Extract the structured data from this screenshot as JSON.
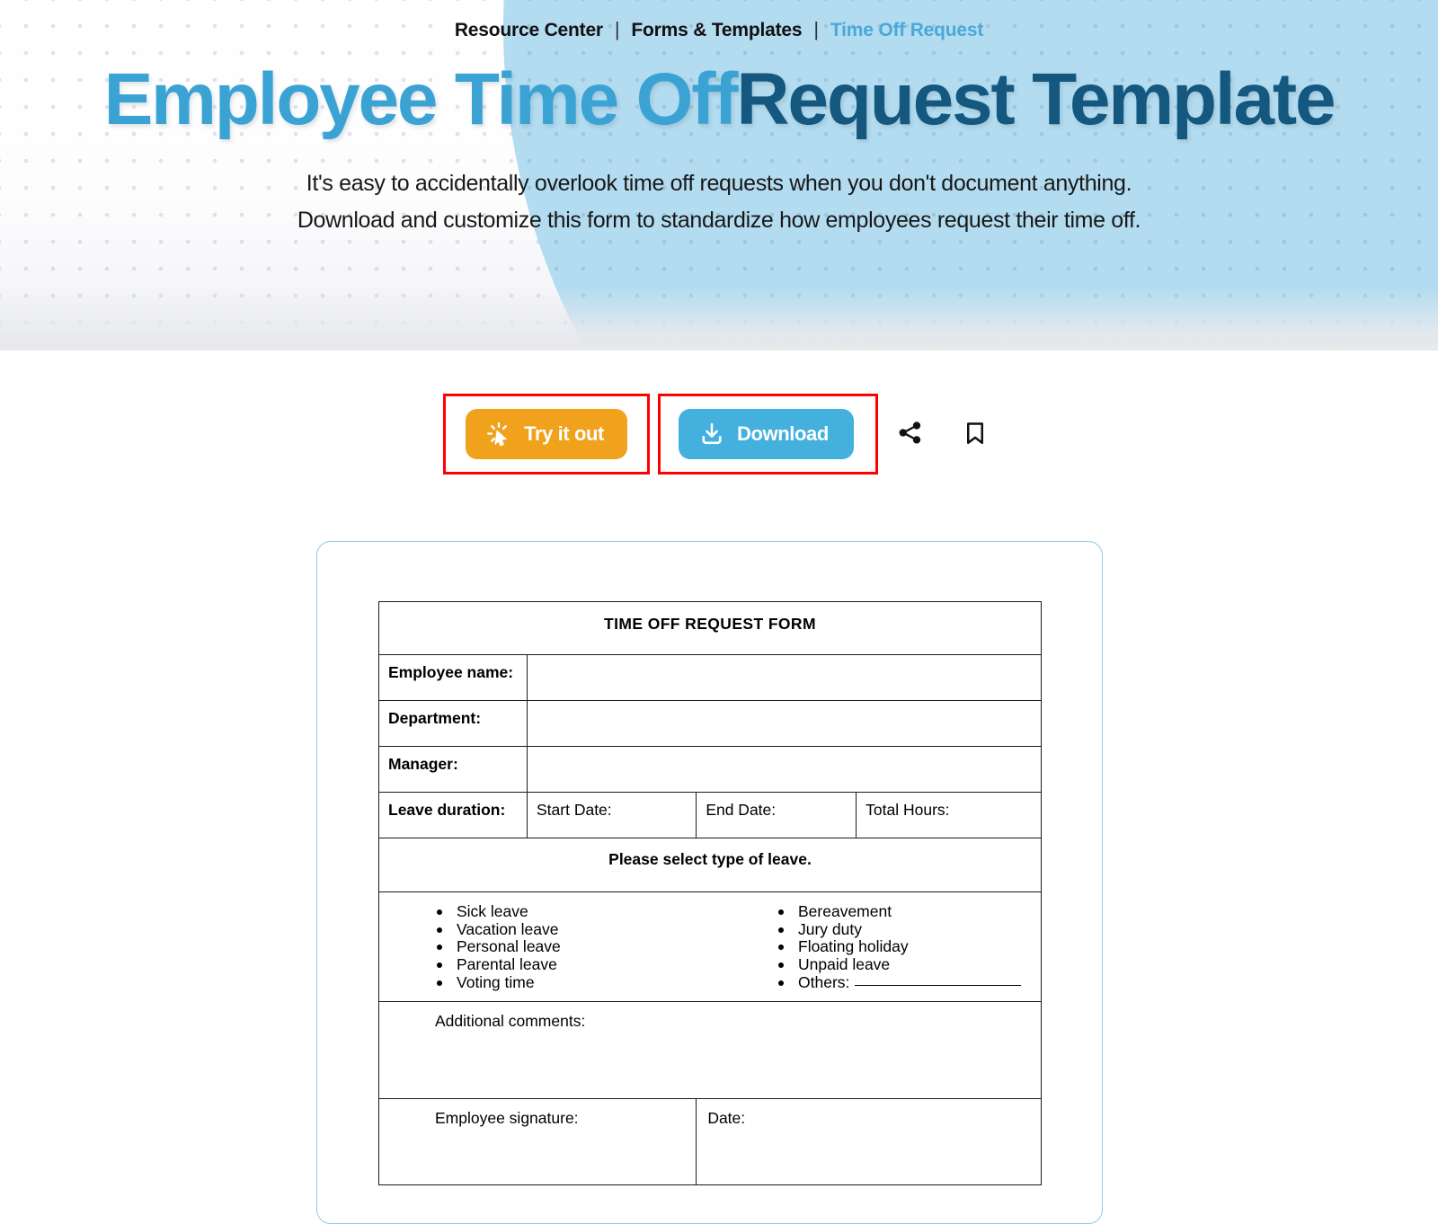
{
  "breadcrumb": {
    "items": [
      "Resource Center",
      "Forms & Templates",
      "Time Off Request"
    ],
    "separator": "|"
  },
  "hero": {
    "title_part1": "Employee Time Off",
    "title_part2": "Request Template",
    "subtitle_line1": "It's easy to accidentally overlook time off requests when you don't document anything.",
    "subtitle_line2": "Download and customize this form to standardize how employees request their time off.",
    "colors": {
      "title_light": "#3ba3d4",
      "title_dark": "#14587f",
      "blob": "#b3dcf0",
      "breadcrumb_current": "#4aa8d8"
    }
  },
  "actions": {
    "try_label": "Try it out",
    "try_icon": "click-cursor-icon",
    "try_color": "#f0a21c",
    "download_label": "Download",
    "download_icon": "download-icon",
    "download_color": "#43b0dd",
    "share_icon": "share-icon",
    "bookmark_icon": "bookmark-icon",
    "annotation_color": "#ff0000"
  },
  "form": {
    "title": "TIME OFF REQUEST FORM",
    "fields": {
      "employee_name": "Employee name:",
      "department": "Department:",
      "manager": "Manager:",
      "leave_duration": "Leave duration:",
      "start_date": "Start Date:",
      "end_date": "End Date:",
      "total_hours": "Total Hours:"
    },
    "section_heading": "Please select type of leave.",
    "leave_types_left": [
      "Sick leave",
      "Vacation leave",
      "Personal leave",
      "Parental leave",
      "Voting time"
    ],
    "leave_types_right": [
      "Bereavement",
      "Jury duty",
      "Floating holiday",
      "Unpaid leave"
    ],
    "others_label": "Others:",
    "additional_comments": "Additional comments:",
    "employee_signature": "Employee signature:",
    "date": "Date:"
  }
}
